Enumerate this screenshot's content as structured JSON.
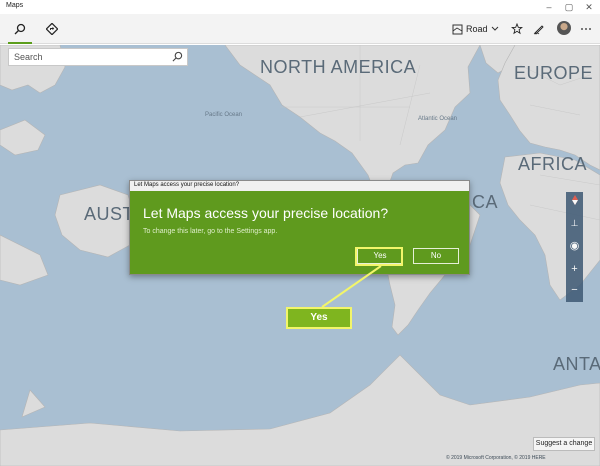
{
  "window": {
    "title": "Maps",
    "minimize": "–",
    "maximize": "▢",
    "close": "✕"
  },
  "toolbar": {
    "tabs": [
      {
        "name": "search-tab",
        "icon": "search-icon"
      },
      {
        "name": "directions-tab",
        "icon": "directions-icon"
      }
    ],
    "road_label": "Road",
    "icons": [
      "map-style-icon",
      "chevron-down-icon",
      "favorites-icon",
      "ink-icon",
      "avatar",
      "more-icon"
    ]
  },
  "search": {
    "placeholder": "Search"
  },
  "map_labels": {
    "north_america": "NORTH AMERICA",
    "europe": "EUROPE",
    "africa": "AFRICA",
    "australia": "AUST",
    "africa_tail": "CA",
    "antarctica": "ANTA",
    "pacific": "Pacific Ocean",
    "atlantic": "Atlantic Ocean"
  },
  "dialog": {
    "titlebar": "Let Maps access your precise location?",
    "heading": "Let Maps access your precise location?",
    "body": "To change this later, go to the Settings app.",
    "yes": "Yes",
    "no": "No"
  },
  "callout": {
    "label": "Yes",
    "color": "#7fb51f",
    "border": "#f2f56a"
  },
  "footer": {
    "suggest": "Suggest a change",
    "copyright": "© 2019 Microsoft Corporation, © 2019 HERE"
  },
  "colors": {
    "ocean": "#a9bfd2",
    "land": "#dcdcdc",
    "accent": "#5f9a1e"
  }
}
